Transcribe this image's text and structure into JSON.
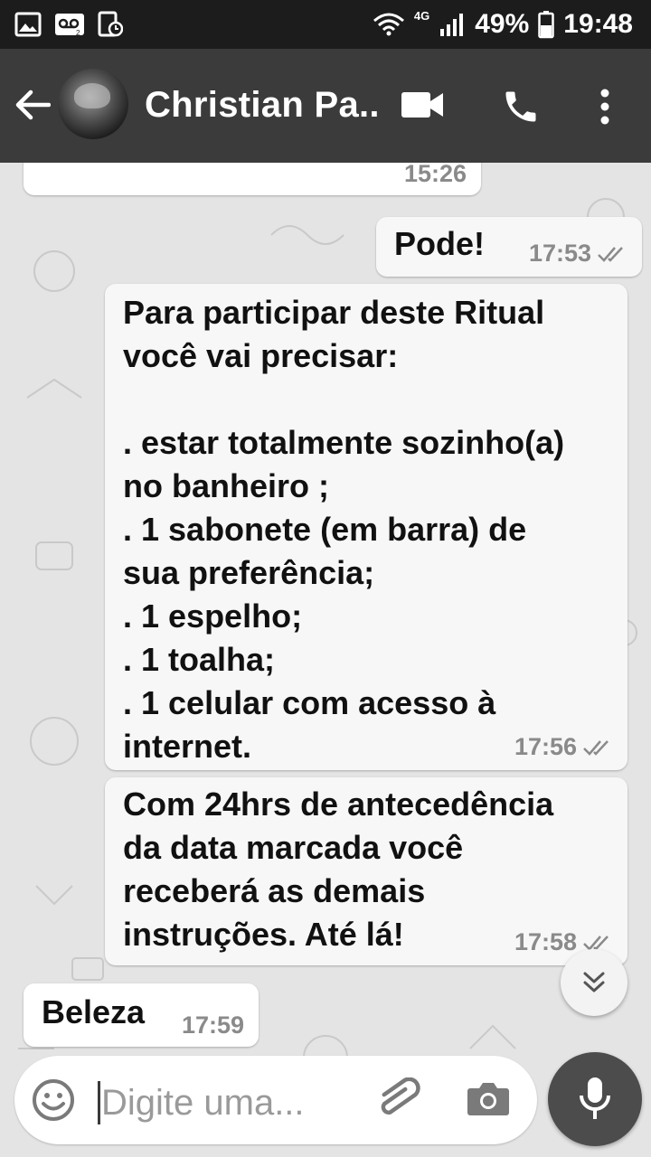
{
  "status_bar": {
    "network": "4G",
    "battery": "49%",
    "time": "19:48",
    "icons": [
      "image-icon",
      "voicemail-icon",
      "screenshot-icon",
      "wifi-icon",
      "signal-icon",
      "battery-icon"
    ]
  },
  "header": {
    "contact_name": "Christian Pa...",
    "icons": [
      "back-arrow-icon",
      "video-call-icon",
      "phone-icon",
      "more-vert-icon"
    ]
  },
  "messages": [
    {
      "direction": "in",
      "text": "",
      "time": "15:26",
      "ticks": false
    },
    {
      "direction": "out",
      "text": "Pode!",
      "time": "17:53",
      "ticks": true
    },
    {
      "direction": "out",
      "text": "Para participar deste Ritual\nvocê vai precisar:\n\n. estar totalmente sozinho(a)\nno banheiro ;\n. 1 sabonete (em barra) de\nsua preferência;\n. 1 espelho;\n. 1 toalha;\n. 1 celular com acesso à\ninternet.",
      "time": "17:56",
      "ticks": true
    },
    {
      "direction": "out",
      "text": "Com 24hrs de antecedência\nda data marcada você\nreceberá as demais\ninstruções. Até lá!",
      "time": "17:58",
      "ticks": true
    },
    {
      "direction": "in",
      "text": "Beleza",
      "time": "17:59",
      "ticks": false
    }
  ],
  "composer": {
    "placeholder": "Digite uma...",
    "icons": [
      "emoji-icon",
      "attach-icon",
      "camera-icon",
      "mic-icon"
    ]
  },
  "scroll_button": {
    "icon": "double-chevron-down-icon"
  }
}
